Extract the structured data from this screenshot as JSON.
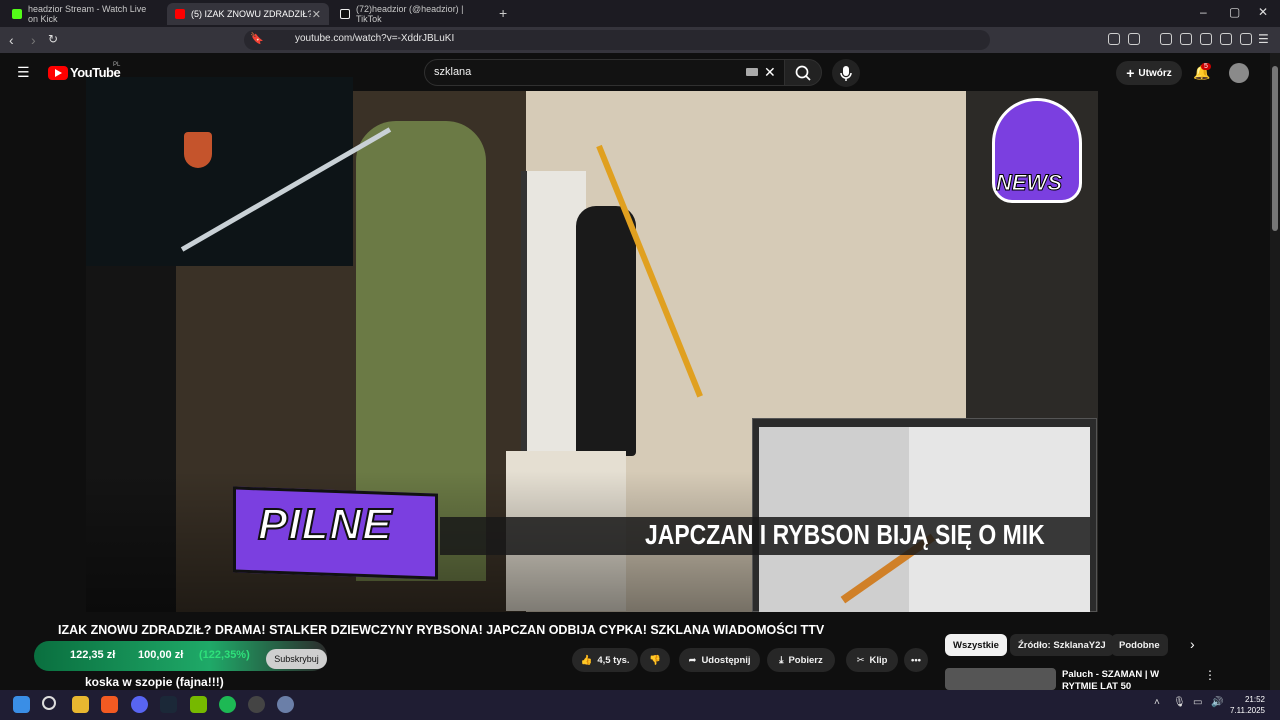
{
  "browser": {
    "tabs": [
      {
        "title": "headzior Stream - Watch Live on Kick",
        "active": false,
        "color": "#53fc18"
      },
      {
        "title": "(5) IZAK ZNOWU ZDRADZIŁ?",
        "active": true,
        "color": "#ff0000"
      },
      {
        "title": "(72)headzior (@headzior) | TikTok",
        "active": false,
        "color": "#ffffff"
      }
    ],
    "new_tab": "+",
    "url": "youtube.com/watch?v=-XddrJBLuKI",
    "window_controls": {
      "minimize": "–",
      "maximize": "▢",
      "close": "✕"
    }
  },
  "youtube": {
    "logo_text": "YouTube",
    "logo_region": "PL",
    "search_value": "szklana",
    "create_label": "Utwórz",
    "notification_count": "5"
  },
  "video": {
    "overlay_pilne": "PILNE",
    "ticker": "JAPCZAN I RYBSON BIJĄ SIĘ O MIK",
    "logo_text": "NEWS",
    "title": "IZAK ZNOWU ZDRADZIŁ? DRAMA! STALKER DZIEWCZYNY RYBSONA! JAPCZAN ODBIJA CYPKA! SZKLANA WIADOMOŚCI TTV"
  },
  "actions": {
    "likes": "4,5 tys.",
    "share": "Udostępnij",
    "download": "Pobierz",
    "clip": "Klip",
    "more": "•••",
    "subscribe": "Subskrybuj"
  },
  "overlay_crypto": {
    "value1": "122,35 zł",
    "value2": "100,00 zł",
    "percent": "(122,35%)"
  },
  "comment_overlay": "koska w szopie (fajna!!!)",
  "filter_chips": [
    {
      "label": "Wszystkie",
      "selected": true
    },
    {
      "label": "Źródło: SzklanaY2J",
      "selected": false
    },
    {
      "label": "Podobne",
      "selected": false
    }
  ],
  "related": {
    "title": "Paluch - SZAMAN | W RYTMIE LAT 50"
  },
  "taskbar": {
    "time": "21:52",
    "date": "7.11.2025"
  }
}
